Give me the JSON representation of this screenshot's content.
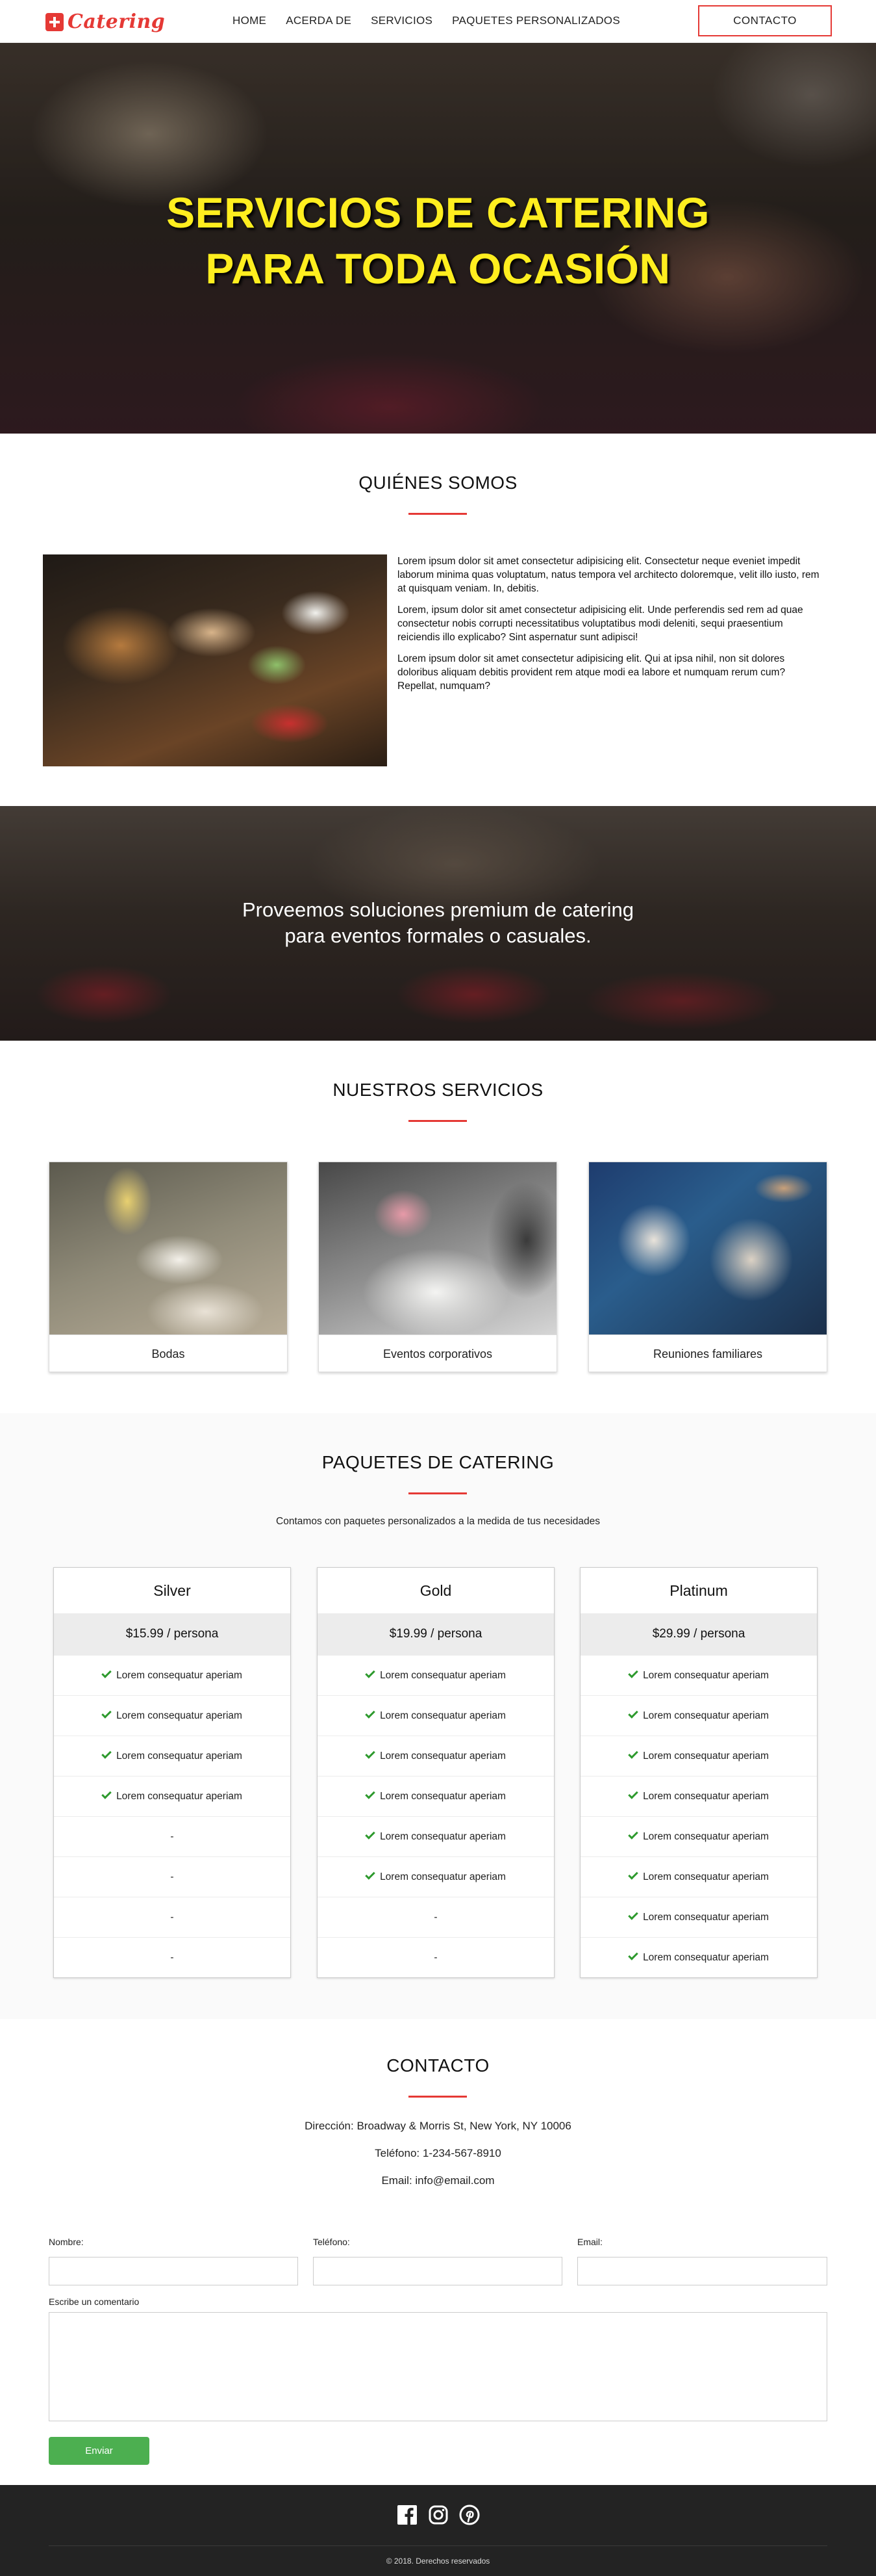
{
  "nav": {
    "logo_text": "Catering",
    "links": [
      "HOME",
      "ACERDA DE",
      "SERVICIOS",
      "PAQUETES PERSONALIZADOS"
    ],
    "contact_label": "CONTACTO",
    "accent": "#e53935"
  },
  "hero": {
    "line1": "SERVICIOS DE CATERING",
    "line2": "PARA TODA OCASIÓN",
    "text_color": "#ffee1f"
  },
  "about": {
    "title": "QUIÉNES SOMOS",
    "paragraphs": [
      "Lorem ipsum dolor sit amet consectetur adipisicing elit. Consectetur neque eveniet impedit laborum minima quas voluptatum, natus tempora vel architecto doloremque, velit illo iusto, rem at quisquam veniam. In, debitis.",
      "Lorem, ipsum dolor sit amet consectetur adipisicing elit. Unde perferendis sed rem ad quae consectetur nobis corrupti necessitatibus voluptatibus modi deleniti, sequi praesentium reiciendis illo explicabo? Sint aspernatur sunt adipisci!",
      "Lorem ipsum dolor sit amet consectetur adipisicing elit. Qui at ipsa nihil, non sit dolores doloribus aliquam debitis provident rem atque modi ea labore et numquam rerum cum? Repellat, numquam?"
    ]
  },
  "banner": {
    "line1": "Proveemos soluciones premium de catering",
    "line2": "para eventos formales o casuales."
  },
  "services": {
    "title": "NUESTROS SERVICIOS",
    "items": [
      {
        "label": "Bodas"
      },
      {
        "label": "Eventos corporativos"
      },
      {
        "label": "Reuniones familiares"
      }
    ]
  },
  "packages": {
    "title": "PAQUETES DE CATERING",
    "subtitle": "Contamos con paquetes personalizados a la medida de tus necesidades",
    "feature_text": "Lorem consequatur aperiam",
    "empty_text": "-",
    "plans": [
      {
        "name": "Silver",
        "price": "$15.99 / persona",
        "included": [
          true,
          true,
          true,
          true,
          false,
          false,
          false,
          false
        ]
      },
      {
        "name": "Gold",
        "price": "$19.99 / persona",
        "included": [
          true,
          true,
          true,
          true,
          true,
          true,
          false,
          false
        ]
      },
      {
        "name": "Platinum",
        "price": "$29.99 / persona",
        "included": [
          true,
          true,
          true,
          true,
          true,
          true,
          true,
          true
        ]
      }
    ],
    "check_color": "#2e9a2e"
  },
  "contact": {
    "title": "CONTACTO",
    "address": "Dirección: Broadway & Morris St, New York, NY 10006",
    "phone": "Teléfono: 1-234-567-8910",
    "email": "Email: info@email.com",
    "form": {
      "name_label": "Nombre:",
      "phone_label": "Teléfono:",
      "email_label": "Email:",
      "comment_label": "Escribe un comentario",
      "submit_label": "Enviar",
      "submit_color": "#4caf50"
    }
  },
  "footer": {
    "social_icons": [
      "facebook-icon",
      "instagram-icon",
      "pinterest-icon"
    ],
    "copyright": "© 2018. Derechos reservados"
  }
}
